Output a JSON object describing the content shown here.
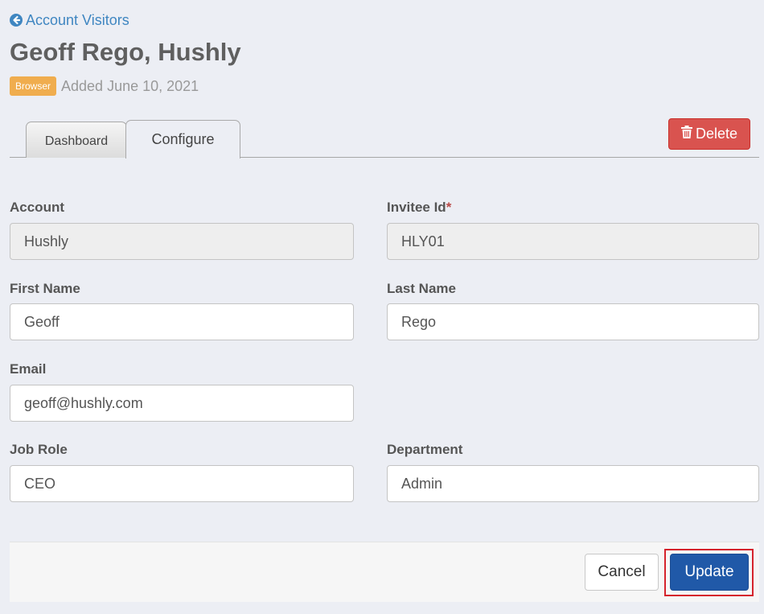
{
  "header": {
    "back_link_label": "Account Visitors",
    "title": "Geoff Rego, Hushly",
    "badge": "Browser",
    "added": "Added June 10, 2021"
  },
  "tabs": [
    {
      "label": "Dashboard",
      "active": false
    },
    {
      "label": "Configure",
      "active": true
    }
  ],
  "actions": {
    "delete_label": "Delete",
    "cancel_label": "Cancel",
    "update_label": "Update"
  },
  "form": {
    "account": {
      "label": "Account",
      "value": "Hushly"
    },
    "invitee_id": {
      "label": "Invitee Id",
      "required_mark": "*",
      "value": "HLY01"
    },
    "first_name": {
      "label": "First Name",
      "value": "Geoff"
    },
    "last_name": {
      "label": "Last Name",
      "value": "Rego"
    },
    "email": {
      "label": "Email",
      "value": "geoff@hushly.com"
    },
    "job_role": {
      "label": "Job Role",
      "value": "CEO"
    },
    "department": {
      "label": "Department",
      "value": "Admin"
    }
  },
  "colors": {
    "link": "#3f86c1",
    "badge": "#f0ad4e",
    "delete": "#d9534f",
    "update": "#2059a8",
    "highlight": "#d5232c"
  },
  "icons": {
    "back": "circle-arrow-left-icon",
    "delete": "trash-icon"
  }
}
